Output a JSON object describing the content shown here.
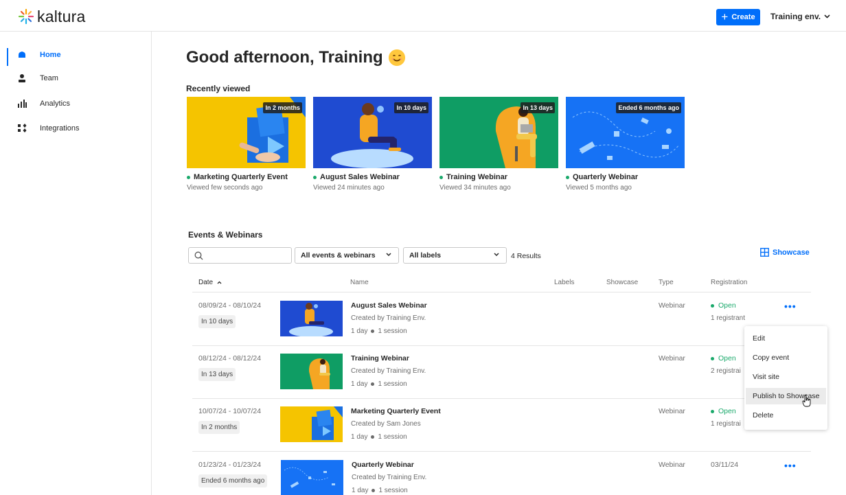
{
  "header": {
    "logo_text": "kaltura",
    "create_label": "Create",
    "environment": "Training env."
  },
  "sidebar": {
    "items": [
      {
        "label": "Home",
        "icon": "home-icon",
        "active": true
      },
      {
        "label": "Team",
        "icon": "person-icon"
      },
      {
        "label": "Analytics",
        "icon": "bar-chart-icon"
      },
      {
        "label": "Integrations",
        "icon": "grid-icon"
      }
    ]
  },
  "greeting": "Good afternoon, Training",
  "recently_viewed": {
    "title": "Recently viewed",
    "cards": [
      {
        "badge": "In 2 months",
        "title": "Marketing Quarterly Event",
        "viewed": "Viewed few seconds ago",
        "thumb_color": "#f5c400"
      },
      {
        "badge": "In 10 days",
        "title": "August Sales Webinar",
        "viewed": "Viewed 24 minutes ago",
        "thumb_color": "#1f4bd1"
      },
      {
        "badge": "In 13 days",
        "title": "Training Webinar",
        "viewed": "Viewed 34 minutes ago",
        "thumb_color": "#0f9d64"
      },
      {
        "badge": "Ended 6 months ago",
        "title": "Quarterly Webinar",
        "viewed": "Viewed 5 months ago",
        "thumb_color": "#1672f5"
      }
    ]
  },
  "events": {
    "title": "Events & Webinars",
    "search_placeholder": "",
    "filter_type": "All events & webinars",
    "filter_labels": "All labels",
    "results": "4 Results",
    "showcase_label": "Showcase",
    "columns": {
      "date": "Date",
      "name": "Name",
      "labels": "Labels",
      "showcase": "Showcase",
      "type": "Type",
      "registration": "Registration"
    },
    "rows": [
      {
        "date": "08/09/24 - 08/10/24",
        "chip": "In 10 days",
        "name": "August Sales Webinar",
        "creator": "Created by Training Env.",
        "duration": "1 day",
        "sessions": "1 session",
        "type": "Webinar",
        "registration": "Open",
        "registrants": "1 registrant"
      },
      {
        "date": "08/12/24 - 08/12/24",
        "chip": "In 13 days",
        "name": "Training Webinar",
        "creator": "Created by Training Env.",
        "duration": "1 day",
        "sessions": "1 session",
        "type": "Webinar",
        "registration": "Open",
        "registrants": "2 registrai"
      },
      {
        "date": "10/07/24 - 10/07/24",
        "chip": "In 2 months",
        "name": "Marketing Quarterly Event",
        "creator": "Created by Sam Jones",
        "duration": "1 day",
        "sessions": "1 session",
        "type": "Webinar",
        "registration": "Open",
        "registrants": "1 registrai"
      },
      {
        "date": "01/23/24 - 01/23/24",
        "chip": "Ended 6 months ago",
        "name": "Quarterly Webinar",
        "creator": "Created by Training Env.",
        "duration": "1 day",
        "sessions": "1 session",
        "type": "Webinar",
        "registration": "03/11/24",
        "registrants": ""
      }
    ]
  },
  "row_menu": {
    "items": [
      "Edit",
      "Copy event",
      "Visit site",
      "Publish to Showcase",
      "Delete"
    ],
    "hovered": "Publish to Showcase"
  },
  "colors": {
    "accent": "#006efa",
    "status_open": "#1aa96b"
  }
}
